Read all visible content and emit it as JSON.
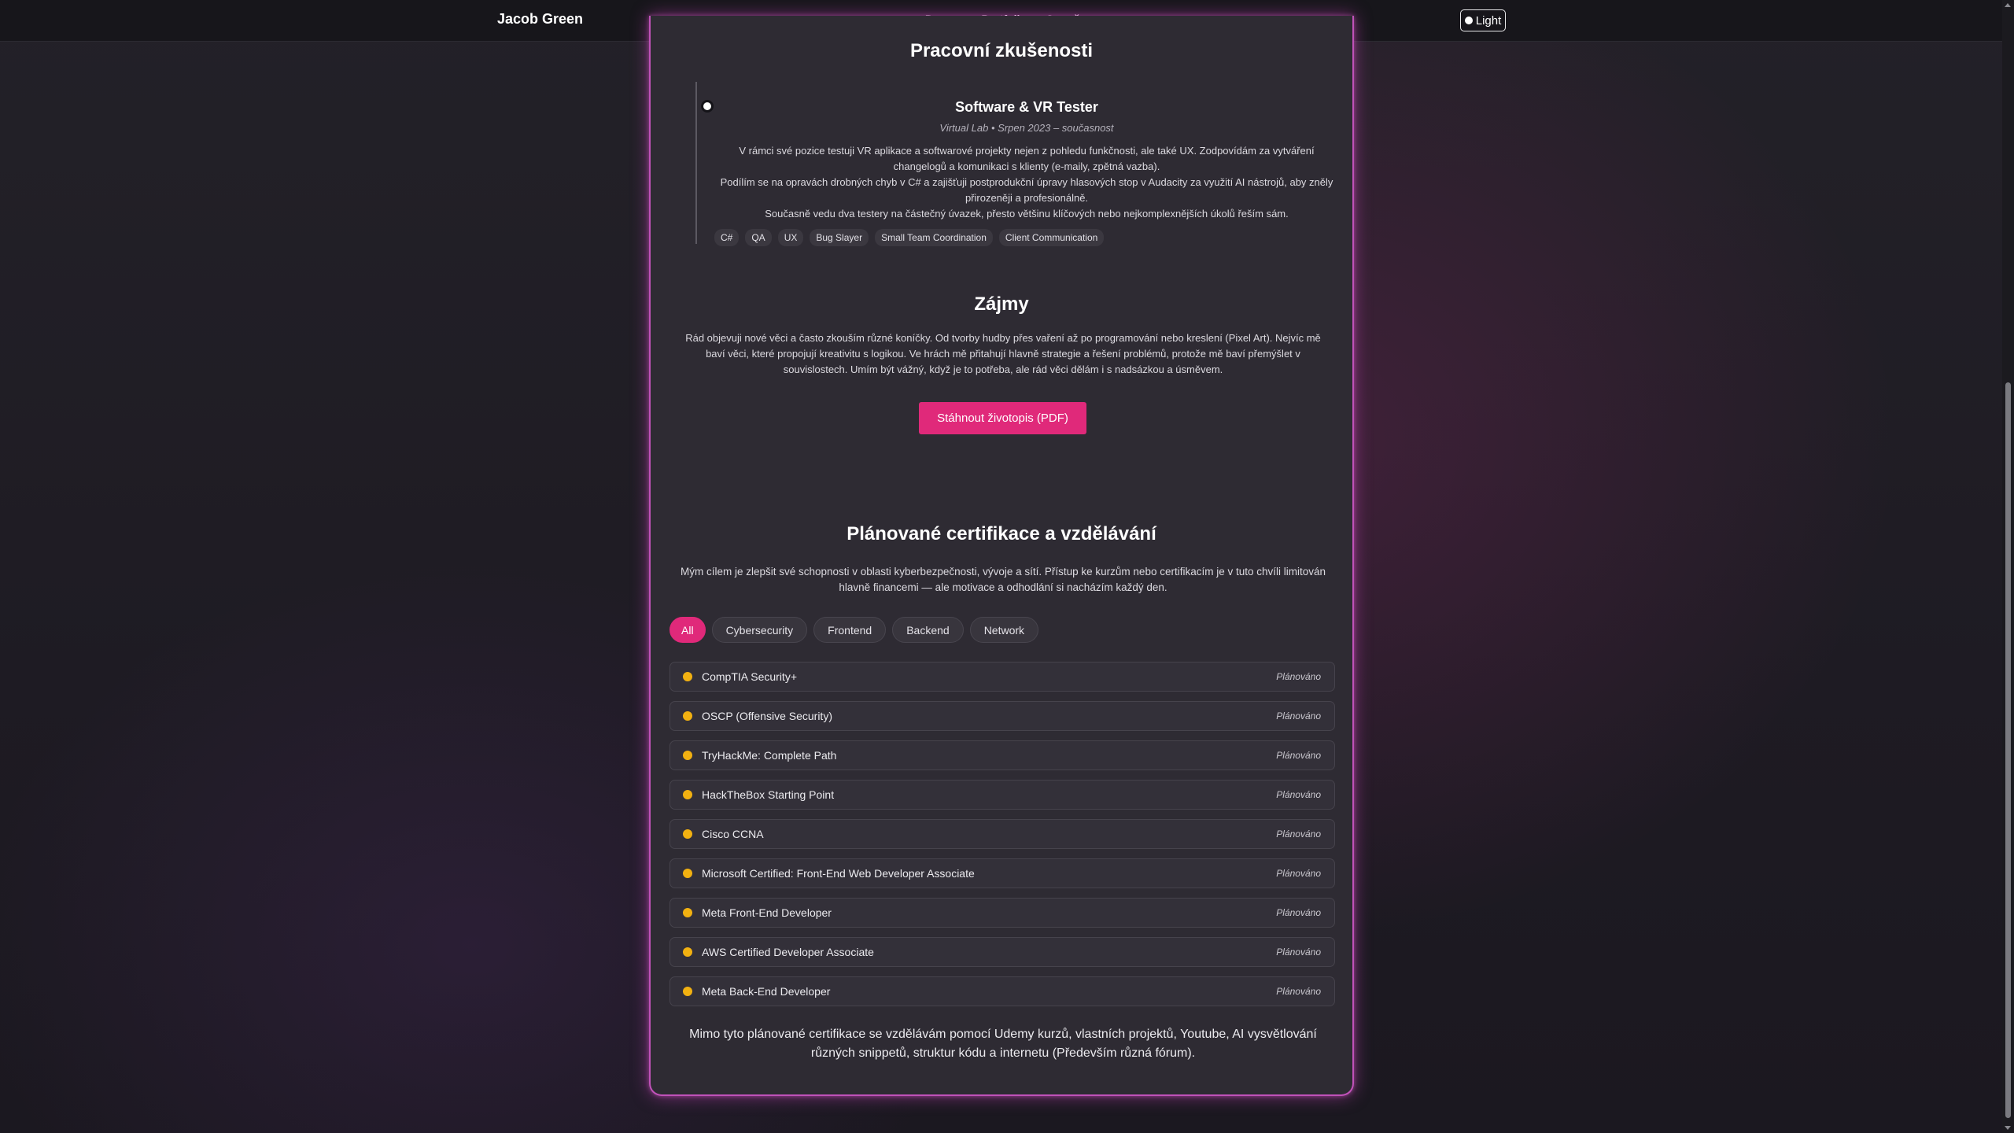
{
  "header": {
    "brand": "Jacob Green",
    "nav": [
      "Domov",
      "Portfolio",
      "O mně"
    ],
    "theme_toggle": "Light"
  },
  "experience": {
    "title": "Pracovní zkušenosti",
    "job": {
      "title": "Software & VR Tester",
      "meta": "Virtual Lab • Srpen 2023 – současnost",
      "desc": [
        "V rámci své pozice testuji VR aplikace a softwarové projekty nejen z pohledu funkčnosti, ale také UX. Zodpovídám za vytváření changelogů a komunikaci s klienty (e-maily, zpětná vazba).",
        "Podílím se na opravách drobných chyb v C# a zajišťuji postprodukční úpravy hlasových stop v Audacity za využití AI nástrojů, aby zněly přirozeněji a profesionálně.",
        "Současně vedu dva testery na částečný úvazek, přesto většinu klíčových nebo nejkomplexnějších úkolů řeším sám."
      ],
      "tags": [
        "C#",
        "QA",
        "UX",
        "Bug Slayer",
        "Small Team Coordination",
        "Client Communication"
      ]
    }
  },
  "interests": {
    "title": "Zájmy",
    "text": "Rád objevuji nové věci a často zkouším různé koníčky. Od tvorby hudby přes vaření až po programování nebo kreslení (Pixel Art). Nejvíc mě baví věci, které propojují kreativitu s logikou. Ve hrách mě přitahují hlavně strategie a řešení problémů, protože mě baví přemýšlet v souvislostech. Umím být vážný, když je to potřeba, ale rád věci dělám i s nadsázkou a úsměvem.",
    "download_button": "Stáhnout životopis (PDF)"
  },
  "certifications": {
    "title": "Plánované certifikace a vzdělávání",
    "intro": "Mým cílem je zlepšit své schopnosti v oblasti kyberbezpečnosti, vývoje a sítí. Přístup ke kurzům nebo certifikacím je v tuto chvíli limitován hlavně financemi — ale motivace a odhodlání si nacházím každý den.",
    "filters": [
      "All",
      "Cybersecurity",
      "Frontend",
      "Backend",
      "Network"
    ],
    "active_filter": "All",
    "items": [
      {
        "name": "CompTIA Security+",
        "status": "Plánováno"
      },
      {
        "name": "OSCP (Offensive Security)",
        "status": "Plánováno"
      },
      {
        "name": "TryHackMe: Complete Path",
        "status": "Plánováno"
      },
      {
        "name": "HackTheBox Starting Point",
        "status": "Plánováno"
      },
      {
        "name": "Cisco CCNA",
        "status": "Plánováno"
      },
      {
        "name": "Microsoft Certified: Front-End Web Developer Associate",
        "status": "Plánováno"
      },
      {
        "name": "Meta Front-End Developer",
        "status": "Plánováno"
      },
      {
        "name": "AWS Certified Developer Associate",
        "status": "Plánováno"
      },
      {
        "name": "Meta Back-End Developer",
        "status": "Plánováno"
      }
    ],
    "footer": "Mimo tyto plánované certifikace se vzdělávám pomocí Udemy kurzů, vlastních projektů, Youtube, AI vysvětlování různých snippetů, struktur kódu a internetu (Především různá fórum)."
  },
  "colors": {
    "accent": "#e0297a",
    "card_glow": "#c052b9",
    "status_dot": "#f2b111"
  }
}
